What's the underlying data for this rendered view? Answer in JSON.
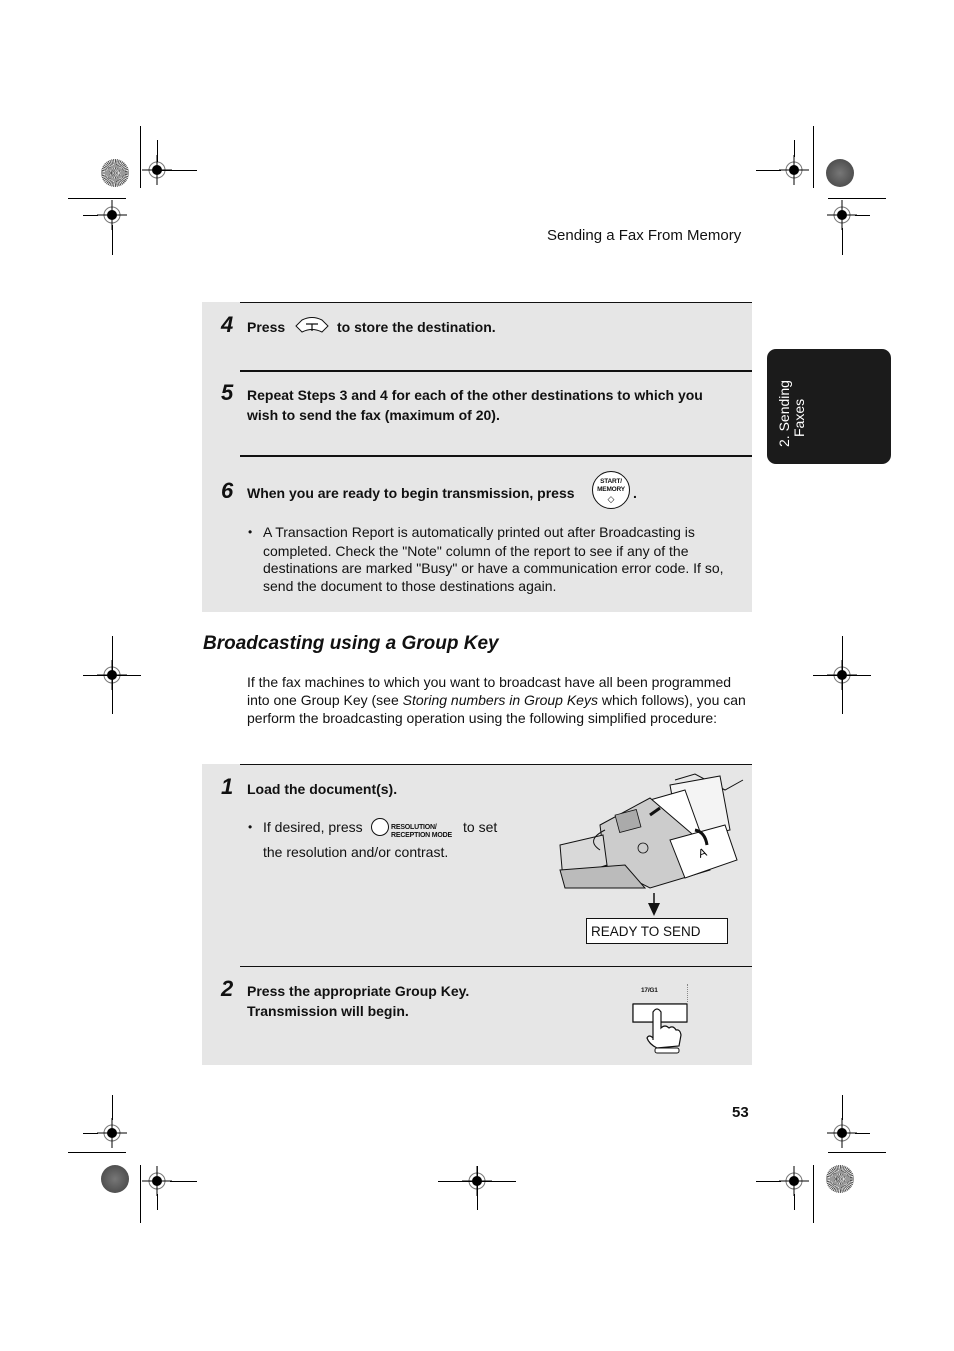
{
  "header": {
    "running_title": "Sending a Fax From Memory"
  },
  "side_tab": {
    "line1": "2. Sending",
    "line2": "Faxes"
  },
  "steps_top": [
    {
      "number": "4",
      "text_before": "Press",
      "icon": "navigation-key-icon",
      "text_after": "to store the destination."
    },
    {
      "number": "5",
      "line1": "Repeat Steps 3 and 4 for each of the other destinations to which you",
      "line2": "wish to send the fax (maximum of 20)."
    },
    {
      "number": "6",
      "text_before": "When you are ready to begin transmission, press",
      "button_label_1": "START/",
      "button_label_2": "MEMORY",
      "text_after": ".",
      "bullet": "•",
      "note_lines": [
        "A Transaction Report is automatically printed out after Broadcasting is",
        "completed. Check the \"Note\" column of the report to see if any of the",
        "destinations are marked \"Busy\" or have a communication error code. If so,",
        "send the document to those destinations again."
      ]
    }
  ],
  "section": {
    "title": "Broadcasting using a Group Key",
    "intro_part1": "If the fax machines to which you want to broadcast have all been programmed into one Group Key (see ",
    "intro_italic": "Storing numbers in Group Keys",
    "intro_part2": " which follows), you can perform the broadcasting operation using the following simplified procedure:"
  },
  "steps_bottom": [
    {
      "number": "1",
      "text": "Load the document(s).",
      "bullet": "•",
      "sub_before": "If desired, press",
      "key_label_1": "RESOLUTION/",
      "key_label_2": "RECEPTION MODE",
      "sub_after": "to set",
      "sub_line2": "the resolution and/or contrast.",
      "display": "READY TO SEND"
    },
    {
      "number": "2",
      "line1": "Press the appropriate Group Key.",
      "line2": "Transmission will begin.",
      "key_label": "17/G1"
    }
  ],
  "footer": {
    "page_number": "53"
  }
}
